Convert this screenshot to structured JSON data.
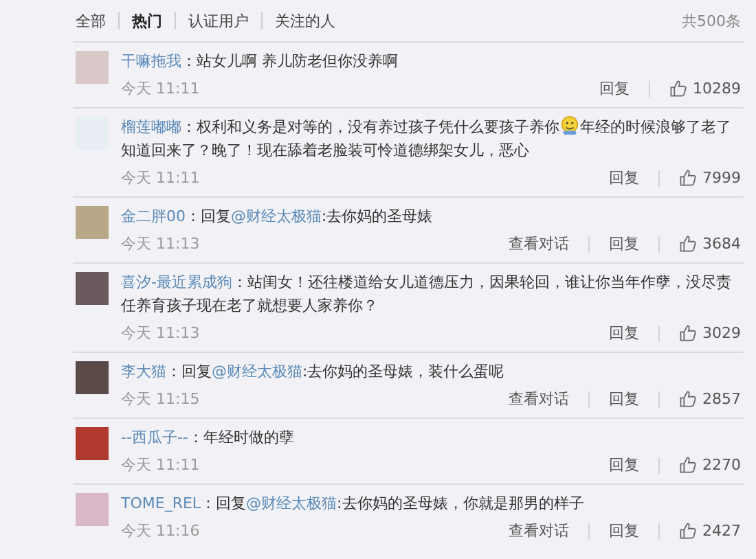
{
  "tabs": [
    {
      "label": "全部",
      "selected": false
    },
    {
      "label": "热门",
      "selected": true
    },
    {
      "label": "认证用户",
      "selected": false
    },
    {
      "label": "关注的人",
      "selected": false
    }
  ],
  "total": "共500条",
  "comments": [
    {
      "author": "干嘛拖我",
      "segments": [
        {
          "kind": "text",
          "text": "：站女儿啊 养儿防老但你没养啊"
        }
      ],
      "time": "今天 11:11",
      "reply": "回复",
      "likes": "10289"
    },
    {
      "author": "榴莲嘟嘟",
      "segments": [
        {
          "kind": "text",
          "text": "：权利和义务是对等的，没有养过孩子凭什么要孩子养你"
        },
        {
          "kind": "emoji"
        },
        {
          "kind": "text",
          "text": "年经的时候浪够了老了知道回来了？晚了！现在舔着老脸装可怜道德绑架女儿，恶心"
        }
      ],
      "time": "今天 11:11",
      "reply": "回复",
      "likes": "7999"
    },
    {
      "author": "金二胖00",
      "segments": [
        {
          "kind": "text",
          "text": "：回复"
        },
        {
          "kind": "mention",
          "text": "@财经太极猫"
        },
        {
          "kind": "text",
          "text": ":去你妈的圣母婊"
        }
      ],
      "time": "今天 11:13",
      "conversation": "查看对话",
      "reply": "回复",
      "likes": "3684"
    },
    {
      "author": "喜汐-最近累成狗",
      "segments": [
        {
          "kind": "text",
          "text": "：站闺女！还往楼道给女儿道德压力，因果轮回，谁让你当年作孽，没尽责任养育孩子现在老了就想要人家养你？"
        }
      ],
      "time": "今天 11:13",
      "reply": "回复",
      "likes": "3029"
    },
    {
      "author": "李大猫",
      "segments": [
        {
          "kind": "text",
          "text": "：回复"
        },
        {
          "kind": "mention",
          "text": "@财经太极猫"
        },
        {
          "kind": "text",
          "text": ":去你妈的圣母婊，装什么蛋呢"
        }
      ],
      "time": "今天 11:15",
      "conversation": "查看对话",
      "reply": "回复",
      "likes": "2857"
    },
    {
      "author": "--西瓜子--",
      "segments": [
        {
          "kind": "text",
          "text": "：年经时做的孽"
        }
      ],
      "time": "今天 11:11",
      "reply": "回复",
      "likes": "2270"
    },
    {
      "author": "TOME_REL",
      "segments": [
        {
          "kind": "text",
          "text": "：回复"
        },
        {
          "kind": "mention",
          "text": "@财经太极猫"
        },
        {
          "kind": "text",
          "text": ":去你妈的圣母婊，你就是那男的样子"
        }
      ],
      "time": "今天 11:16",
      "conversation": "查看对话",
      "reply": "回复",
      "likes": "2427"
    }
  ]
}
